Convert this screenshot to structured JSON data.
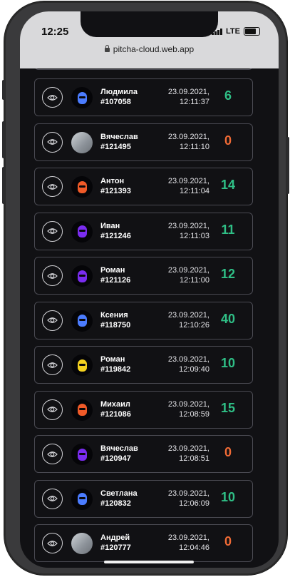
{
  "status": {
    "time": "12:25",
    "network": "LTE"
  },
  "browser": {
    "url": "pitcha-cloud.web.app"
  },
  "colors": {
    "positive": "#2fbf86",
    "zero": "#ef6a35"
  },
  "rows": [
    {
      "name": "Людмила",
      "id": "#107058",
      "date": "23.09.2021,",
      "time": "12:11:37",
      "score": "6",
      "avatar": "helmet",
      "helmet_color": "#4b7cff"
    },
    {
      "name": "Вячеслав",
      "id": "#121495",
      "date": "23.09.2021,",
      "time": "12:11:10",
      "score": "0",
      "avatar": "photo"
    },
    {
      "name": "Антон",
      "id": "#121393",
      "date": "23.09.2021,",
      "time": "12:11:04",
      "score": "14",
      "avatar": "helmet",
      "helmet_color": "#f05a28"
    },
    {
      "name": "Иван",
      "id": "#121246",
      "date": "23.09.2021,",
      "time": "12:11:03",
      "score": "11",
      "avatar": "helmet",
      "helmet_color": "#7a2cf0"
    },
    {
      "name": "Роман",
      "id": "#121126",
      "date": "23.09.2021,",
      "time": "12:11:00",
      "score": "12",
      "avatar": "helmet",
      "helmet_color": "#7a2cf0"
    },
    {
      "name": "Ксения",
      "id": "#118750",
      "date": "23.09.2021,",
      "time": "12:10:26",
      "score": "40",
      "avatar": "helmet",
      "helmet_color": "#4b7cff"
    },
    {
      "name": "Роман",
      "id": "#119842",
      "date": "23.09.2021,",
      "time": "12:09:40",
      "score": "10",
      "avatar": "helmet",
      "helmet_color": "#f5d21f"
    },
    {
      "name": "Михаил",
      "id": "#121086",
      "date": "23.09.2021,",
      "time": "12:08:59",
      "score": "15",
      "avatar": "helmet",
      "helmet_color": "#f05a28"
    },
    {
      "name": "Вячеслав",
      "id": "#120947",
      "date": "23.09.2021,",
      "time": "12:08:51",
      "score": "0",
      "avatar": "helmet",
      "helmet_color": "#7a2cf0"
    },
    {
      "name": "Светлана",
      "id": "#120832",
      "date": "23.09.2021,",
      "time": "12:06:09",
      "score": "10",
      "avatar": "helmet",
      "helmet_color": "#4b7cff"
    },
    {
      "name": "Андрей",
      "id": "#120777",
      "date": "23.09.2021,",
      "time": "12:04:46",
      "score": "0",
      "avatar": "photo"
    }
  ]
}
